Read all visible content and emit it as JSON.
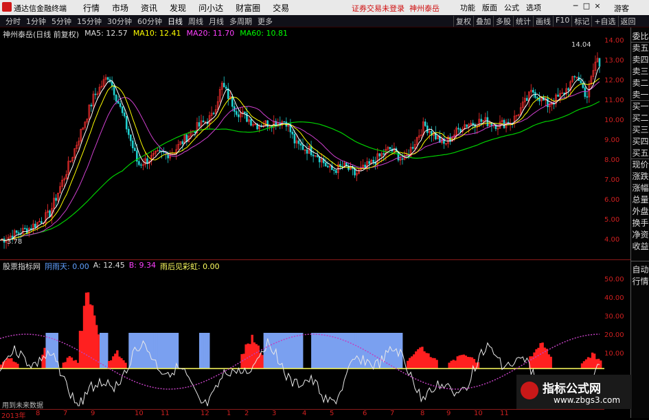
{
  "titlebar": {
    "app_name": "通达信金融终端",
    "menus": [
      "行情",
      "市场",
      "资讯",
      "发现",
      "问小达",
      "财富圈",
      "交易"
    ],
    "notice_1": "证券交易未登录",
    "notice_2": "神州泰岳",
    "right_menus": [
      "功能",
      "版面",
      "公式",
      "选项"
    ],
    "window_controls": [
      "─",
      "□",
      "×"
    ],
    "guest": "游客"
  },
  "periodbar": {
    "periods": [
      "分时",
      "1分钟",
      "5分钟",
      "15分钟",
      "30分钟",
      "60分钟",
      "日线",
      "周线",
      "月线",
      "多周期",
      "更多"
    ],
    "active_period": "日线",
    "tools": [
      "复权",
      "叠加",
      "多股",
      "统计",
      "画线",
      "F10",
      "标记",
      "+自选",
      "返回"
    ]
  },
  "main_chart": {
    "stock_label": "神州泰岳(日线 前复权)",
    "ma5": "MA5: 12.57",
    "ma10": "MA10: 12.41",
    "ma20": "MA20: 11.70",
    "ma60": "MA60: 10.81",
    "price_max_label": "14.04",
    "price_min_label": "3.78",
    "y_ticks": [
      "14.00",
      "13.00",
      "12.00",
      "11.00",
      "10.00",
      "9.00",
      "8.00",
      "7.00",
      "6.00",
      "5.00",
      "4.00"
    ]
  },
  "indicator": {
    "name": "股票指标网",
    "line1": "阴雨天: 0.00",
    "line2": "A: 12.45",
    "line3": "B: 9.34",
    "line4": "雨后见彩虹: 0.00",
    "y_ticks": [
      "50.00",
      "40.00",
      "30.00",
      "20.00",
      "10.00"
    ],
    "footnote": "用到未来数据"
  },
  "x_axis": {
    "ticks": [
      "2013年",
      "8",
      "7",
      "9",
      "10",
      "11",
      "12",
      "1",
      "2",
      "3",
      "4",
      "5",
      "6",
      "7",
      "8",
      "9",
      "10",
      "11"
    ]
  },
  "sidepanel": {
    "items": [
      "委比",
      "卖五",
      "卖四",
      "卖三",
      "卖二",
      "卖一",
      "买一",
      "买二",
      "买三",
      "买四",
      "买五",
      "现价",
      "涨跌",
      "涨幅",
      "总量",
      "外盘",
      "换手",
      "净资",
      "收益"
    ],
    "bottom_items": [
      "自动",
      "行情"
    ]
  },
  "watermark": {
    "title": "指标公式网",
    "url": "www.zbgs3.com"
  },
  "colors": {
    "ma5": "#ffffff",
    "ma10": "#ffff00",
    "ma20": "#ff40ff",
    "ma60": "#00ff00",
    "up": "#ff2020",
    "bar_blue": "#7aa0f0",
    "axis": "#d02020"
  }
}
